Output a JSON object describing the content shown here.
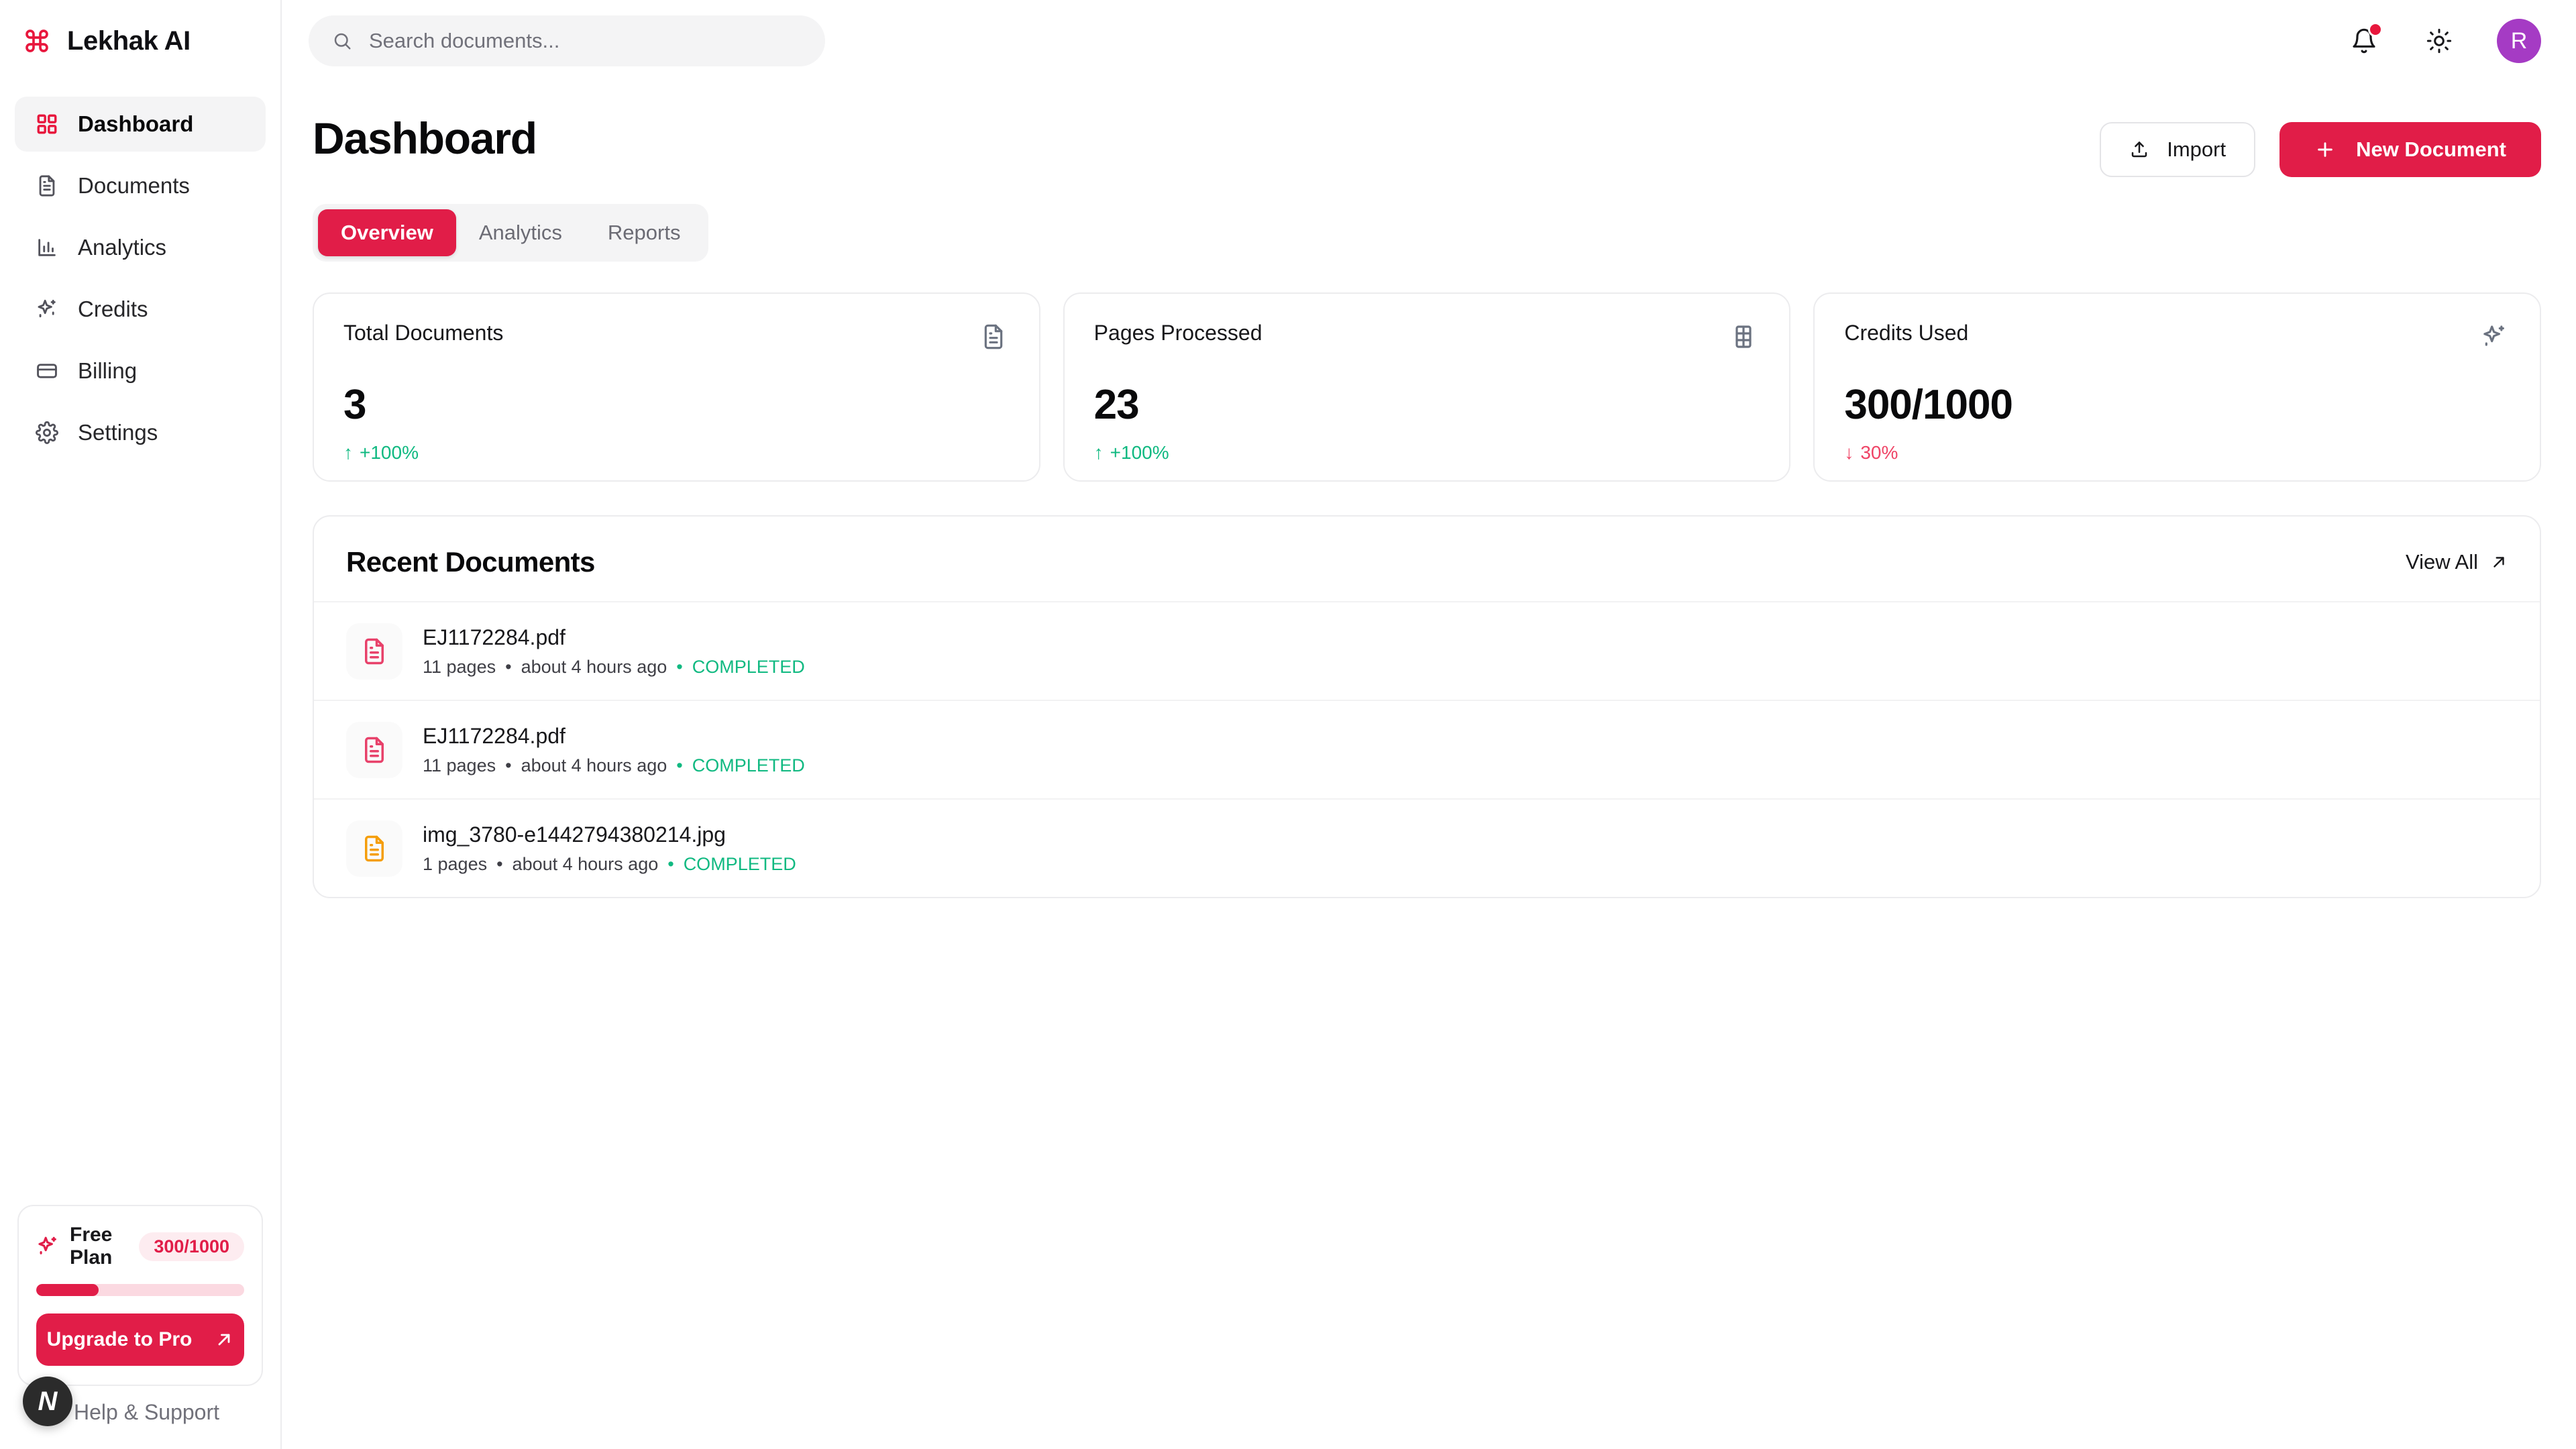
{
  "brand": {
    "name": "Lekhak AI",
    "logo_icon": "command-icon",
    "accent": "#e11d48"
  },
  "sidebar": {
    "items": [
      {
        "label": "Dashboard",
        "icon": "grid-icon",
        "active": true
      },
      {
        "label": "Documents",
        "icon": "file-text-icon",
        "active": false
      },
      {
        "label": "Analytics",
        "icon": "bar-chart-icon",
        "active": false
      },
      {
        "label": "Credits",
        "icon": "sparkles-icon",
        "active": false
      },
      {
        "label": "Billing",
        "icon": "credit-card-icon",
        "active": false
      },
      {
        "label": "Settings",
        "icon": "gear-icon",
        "active": false
      }
    ],
    "plan": {
      "icon": "sparkles-icon",
      "name": "Free Plan",
      "usage_badge": "300/1000",
      "progress_percent": 30,
      "upgrade_label": "Upgrade to Pro",
      "upgrade_icon": "arrow-up-right-icon",
      "badge_bg": "#fdecf0",
      "badge_color": "#e11d48"
    },
    "help": {
      "label": "Help & Support",
      "icon": "help-circle-icon"
    },
    "dev_badge": {
      "label": "N"
    }
  },
  "topbar": {
    "search": {
      "placeholder": "Search documents...",
      "value": "",
      "icon": "search-icon"
    },
    "notifications": {
      "icon": "bell-icon",
      "has_unread": true,
      "dot_color": "#e8173d"
    },
    "theme_toggle": {
      "icon": "sun-icon"
    },
    "avatar": {
      "initial": "R",
      "color": "#a53bc4"
    }
  },
  "page": {
    "title": "Dashboard",
    "actions": [
      {
        "label": "Import",
        "icon": "upload-icon",
        "style": "outline"
      },
      {
        "label": "New Document",
        "icon": "plus-icon",
        "style": "primary"
      }
    ],
    "tabs": [
      {
        "label": "Overview",
        "active": true
      },
      {
        "label": "Analytics",
        "active": false
      },
      {
        "label": "Reports",
        "active": false
      }
    ]
  },
  "stats": [
    {
      "label": "Total Documents",
      "value": "3",
      "trend_arrow": "↑",
      "trend": "+100%",
      "trend_dir": "up",
      "icon": "file-text-icon"
    },
    {
      "label": "Pages Processed",
      "value": "23",
      "trend_arrow": "↑",
      "trend": "+100%",
      "trend_dir": "up",
      "icon": "table-icon"
    },
    {
      "label": "Credits Used",
      "value": "300/1000",
      "trend_arrow": "↓",
      "trend": "30%",
      "trend_dir": "down",
      "icon": "sparkles-icon"
    }
  ],
  "recent": {
    "title": "Recent Documents",
    "view_all": {
      "label": "View All",
      "icon": "arrow-up-right-icon"
    },
    "documents": [
      {
        "name": "EJ1172284.pdf",
        "pages": "11 pages",
        "separator": "•",
        "time": "about 4 hours ago",
        "status_dot": "•",
        "status": "COMPLETED",
        "icon": "file-text-icon",
        "icon_color": "#e8416a"
      },
      {
        "name": "EJ1172284.pdf",
        "pages": "11 pages",
        "separator": "•",
        "time": "about 4 hours ago",
        "status_dot": "•",
        "status": "COMPLETED",
        "icon": "file-text-icon",
        "icon_color": "#e8416a"
      },
      {
        "name": "img_3780-e1442794380214.jpg",
        "pages": "1 pages",
        "separator": "•",
        "time": "about 4 hours ago",
        "status_dot": "•",
        "status": "COMPLETED",
        "icon": "file-text-icon",
        "icon_color": "#f59e0b"
      }
    ]
  }
}
